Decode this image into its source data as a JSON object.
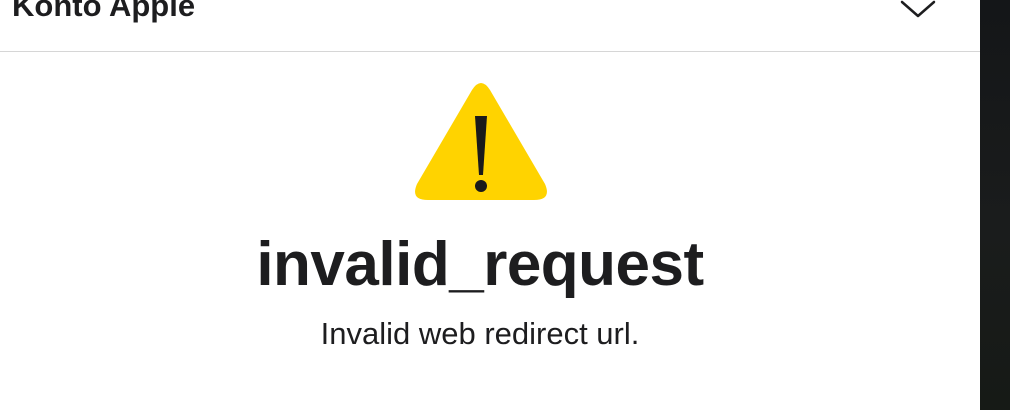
{
  "header": {
    "title": "Konto Apple",
    "chevron_icon": "chevron-down-icon"
  },
  "error": {
    "icon": "warning-icon",
    "icon_color": "#FFD300",
    "title": "invalid_request",
    "message": "Invalid web redirect url."
  }
}
